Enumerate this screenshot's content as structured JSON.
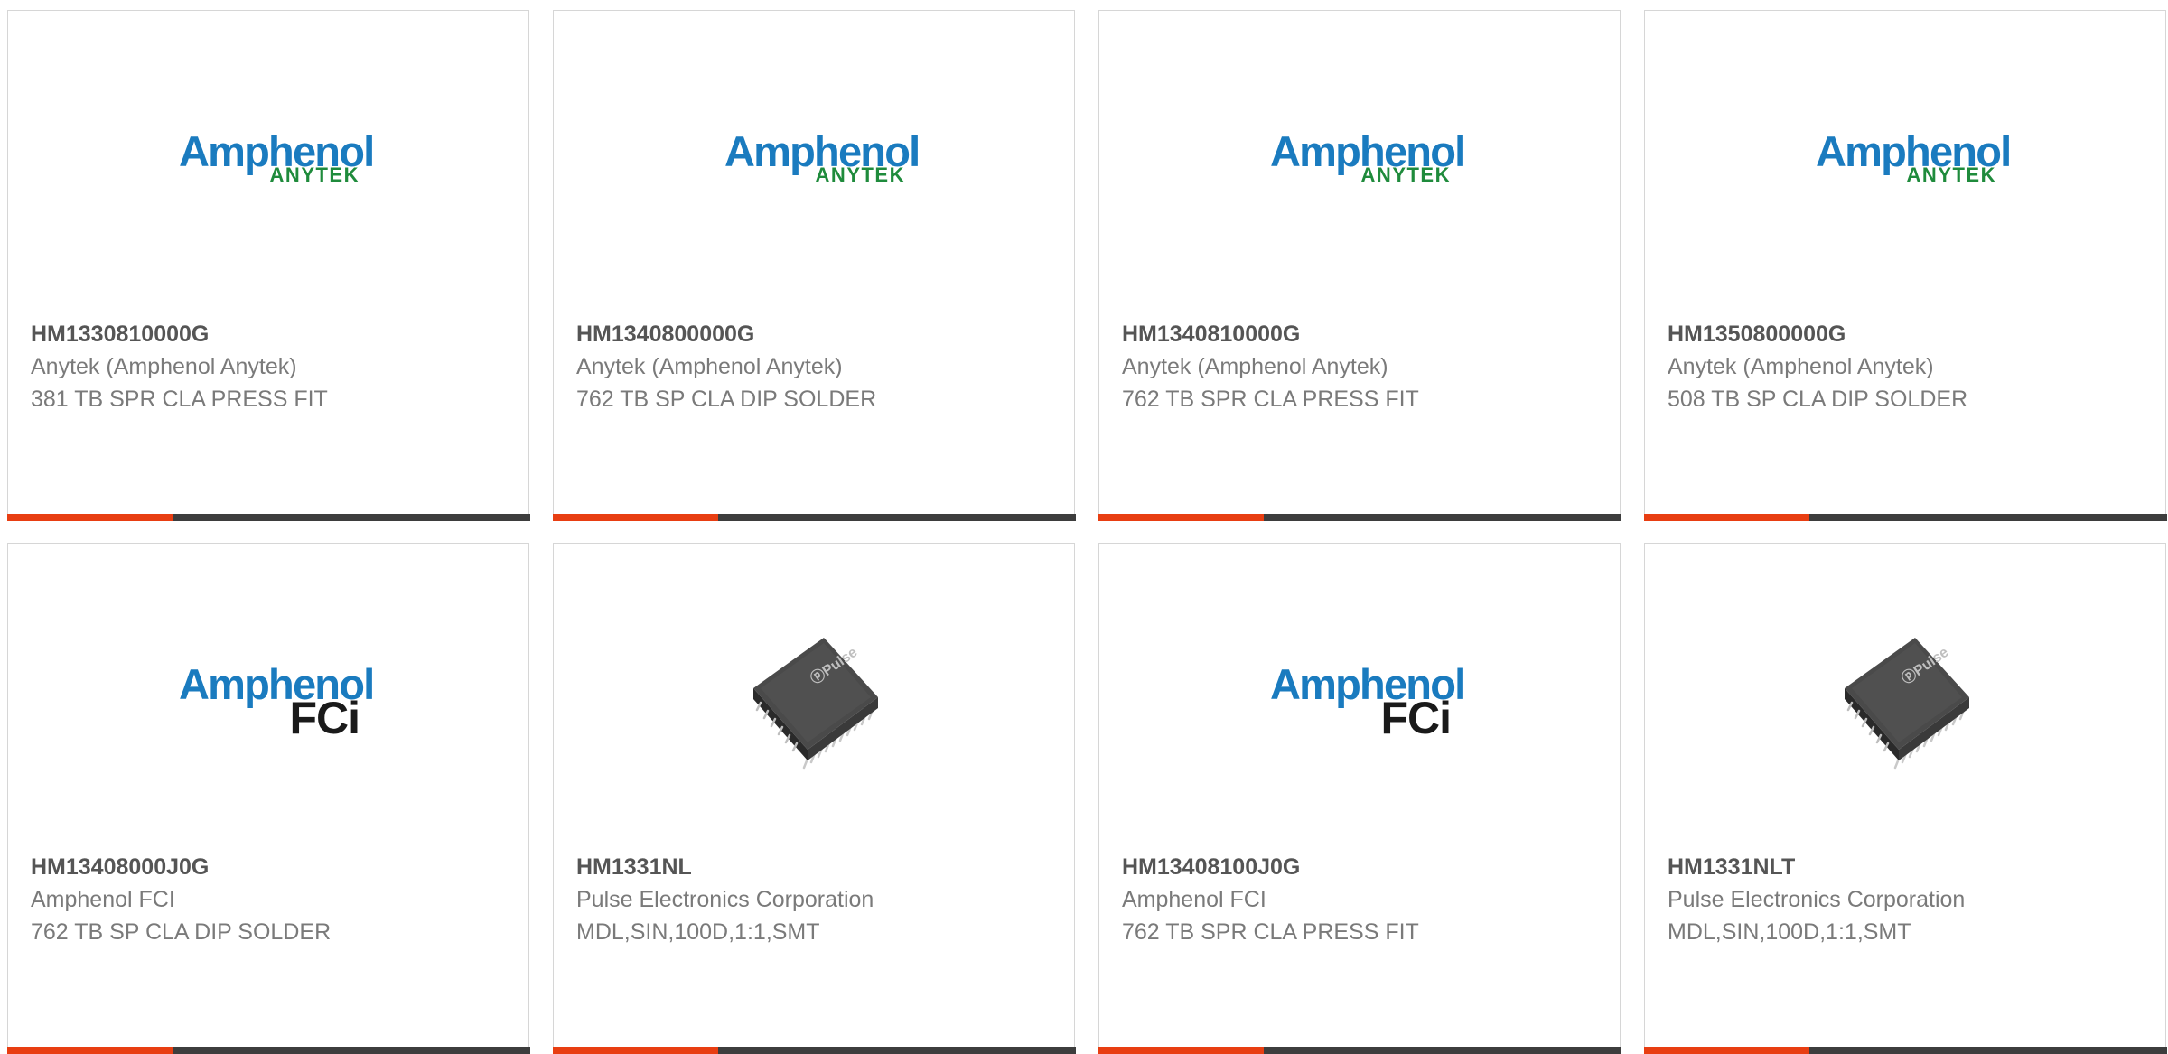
{
  "colors": {
    "accent": "#e83e12",
    "bar": "#3d3d3d",
    "amphenol_blue": "#1a7bbf",
    "anytek_green": "#1f8b3c",
    "fci_black": "#1a1a1a"
  },
  "products": [
    {
      "part_number": "HM1330810000G",
      "manufacturer": "Anytek (Amphenol Anytek)",
      "description": "381 TB SPR CLA PRESS FIT",
      "image": "amphenol-anytek-logo",
      "logo": {
        "brand": "Amphenol",
        "sub": "ANYTEK"
      }
    },
    {
      "part_number": "HM1340800000G",
      "manufacturer": "Anytek (Amphenol Anytek)",
      "description": "762 TB SP CLA DIP SOLDER",
      "image": "amphenol-anytek-logo",
      "logo": {
        "brand": "Amphenol",
        "sub": "ANYTEK"
      }
    },
    {
      "part_number": "HM1340810000G",
      "manufacturer": "Anytek (Amphenol Anytek)",
      "description": "762 TB SPR CLA PRESS FIT",
      "image": "amphenol-anytek-logo",
      "logo": {
        "brand": "Amphenol",
        "sub": "ANYTEK"
      }
    },
    {
      "part_number": "HM1350800000G",
      "manufacturer": "Anytek (Amphenol Anytek)",
      "description": "508 TB SP CLA DIP SOLDER",
      "image": "amphenol-anytek-logo",
      "logo": {
        "brand": "Amphenol",
        "sub": "ANYTEK"
      }
    },
    {
      "part_number": "HM13408000J0G",
      "manufacturer": "Amphenol FCI",
      "description": "762 TB SP CLA DIP SOLDER",
      "image": "amphenol-fci-logo",
      "logo": {
        "brand": "Amphenol",
        "sub": "FCi"
      }
    },
    {
      "part_number": "HM1331NL",
      "manufacturer": "Pulse Electronics Corporation",
      "description": "MDL,SIN,100D,1:1,SMT",
      "image": "pulse-transformer-chip",
      "logo": {
        "brand": "Pulse"
      }
    },
    {
      "part_number": "HM13408100J0G",
      "manufacturer": "Amphenol FCI",
      "description": "762 TB SPR CLA PRESS FIT",
      "image": "amphenol-fci-logo",
      "logo": {
        "brand": "Amphenol",
        "sub": "FCi"
      }
    },
    {
      "part_number": "HM1331NLT",
      "manufacturer": "Pulse Electronics Corporation",
      "description": "MDL,SIN,100D,1:1,SMT",
      "image": "pulse-transformer-chip",
      "logo": {
        "brand": "Pulse"
      }
    }
  ]
}
